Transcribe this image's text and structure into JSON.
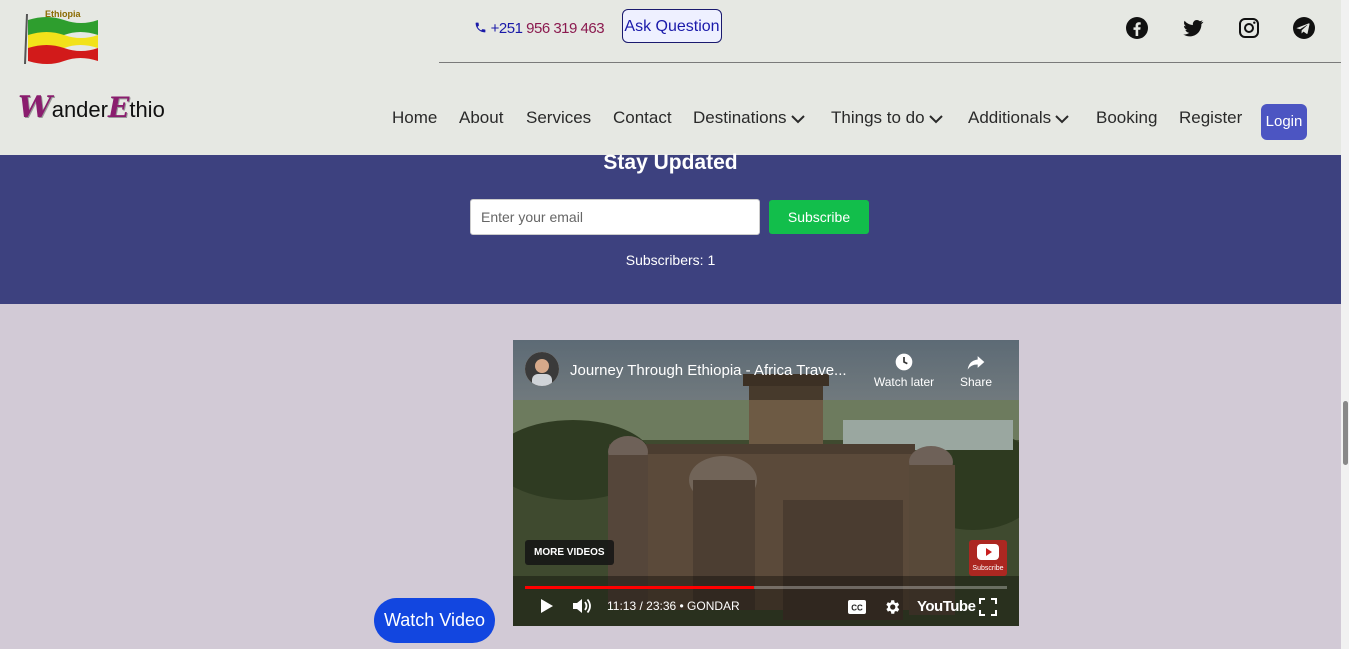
{
  "header": {
    "flag_caption": "Ethiopia",
    "phone_prefix": "+251",
    "phone_number": "956 319 463",
    "ask_button": "Ask Question",
    "social": [
      "facebook-icon",
      "twitter-icon",
      "instagram-icon",
      "telegram-icon"
    ]
  },
  "logo": {
    "w": "W",
    "ander": "ander",
    "e": "E",
    "thio": "thio"
  },
  "nav": {
    "home": "Home",
    "about": "About",
    "services": "Services",
    "contact": "Contact",
    "destinations": "Destinations",
    "things": "Things to do",
    "additionals": "Additionals",
    "booking": "Booking",
    "register": "Register",
    "login": "Login"
  },
  "newsletter": {
    "title": "Stay Updated",
    "email_placeholder": "Enter your email",
    "subscribe": "Subscribe",
    "count_text": "Subscribers: 1"
  },
  "video": {
    "title": "Journey Through Ethiopia - Africa Trave...",
    "watch_later": "Watch later",
    "share": "Share",
    "more_videos": "MORE VIDEOS",
    "time": "11:13 / 23:36",
    "chapter": "GONDAR",
    "platform": "YouTube",
    "subscribe_badge": "Subscribe",
    "progress": 0.475
  },
  "watch_video": "Watch Video",
  "colors": {
    "nav_band": "#3d417f",
    "subscribe_green": "#12be4b",
    "login_blue": "#4c55c2",
    "watch_blue": "#1246e0"
  }
}
